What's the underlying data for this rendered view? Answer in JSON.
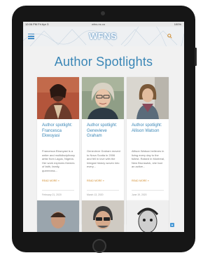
{
  "status_bar": {
    "time": "12:06 PM  Fri Apr 3",
    "url": "wfns.ns.ca",
    "battery": "100%"
  },
  "header": {
    "logo_text": "WFNS",
    "menu_icon": "hamburger-icon",
    "search_icon": "search-icon"
  },
  "main": {
    "page_title": "Author Spotlights",
    "cards": [
      {
        "title": "Author spotlight: Francesca Ekwuyasi",
        "excerpt": "Francesca Ekwuyasi is a writer and multidisciplinary artist from Lagos, Nigeria. Her work explores themes of faith, family, queerness...",
        "read_more": "READ MORE »",
        "date": "February 21, 2020"
      },
      {
        "title": "Author spotlight: Genevieve Graham",
        "excerpt": "Genevieve Graham moved to Nova Scotia in 2006 and fell in love with the Integral history woven into every...",
        "read_more": "READ MORE »",
        "date": "March 13, 2020"
      },
      {
        "title": "Author spotlight: Allison Watson",
        "excerpt": "Allison Watson believes in living every day to the fullest. Raised in Montreal, New Brunswick, she had an active...",
        "read_more": "READ MORE »",
        "date": "June 19, 2020"
      }
    ]
  },
  "colors": {
    "accent": "#3a86b6",
    "read_more": "#d08a2a",
    "device": "#161616"
  }
}
